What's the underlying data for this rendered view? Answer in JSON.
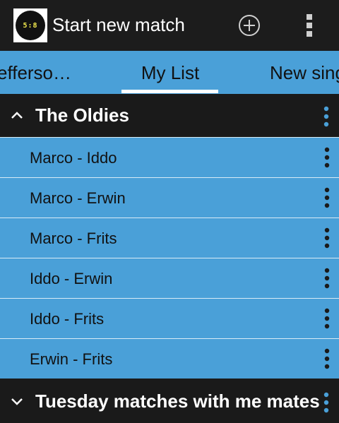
{
  "appbar": {
    "icon_text": "5:8",
    "title": "Start new match",
    "add_icon": "add-circle-icon",
    "overflow_icon": "overflow-menu-icon"
  },
  "tabs": [
    {
      "label": "efferso…",
      "selected": false
    },
    {
      "label": "My List",
      "selected": true
    },
    {
      "label": "New sing",
      "selected": false
    }
  ],
  "groups": [
    {
      "title": "The Oldies",
      "expanded": true,
      "items": [
        {
          "label": "Marco - Iddo"
        },
        {
          "label": "Marco - Erwin"
        },
        {
          "label": "Marco - Frits"
        },
        {
          "label": "Iddo - Erwin"
        },
        {
          "label": "Iddo - Frits"
        },
        {
          "label": "Erwin - Frits"
        }
      ]
    },
    {
      "title": "Tuesday matches with me mates",
      "expanded": false,
      "items": []
    }
  ],
  "colors": {
    "accent": "#4aa0d8",
    "header_bg": "#1a1a1a",
    "menu_dot_blue": "#4aa0d8",
    "menu_dot_dark": "#1a1a1a"
  }
}
